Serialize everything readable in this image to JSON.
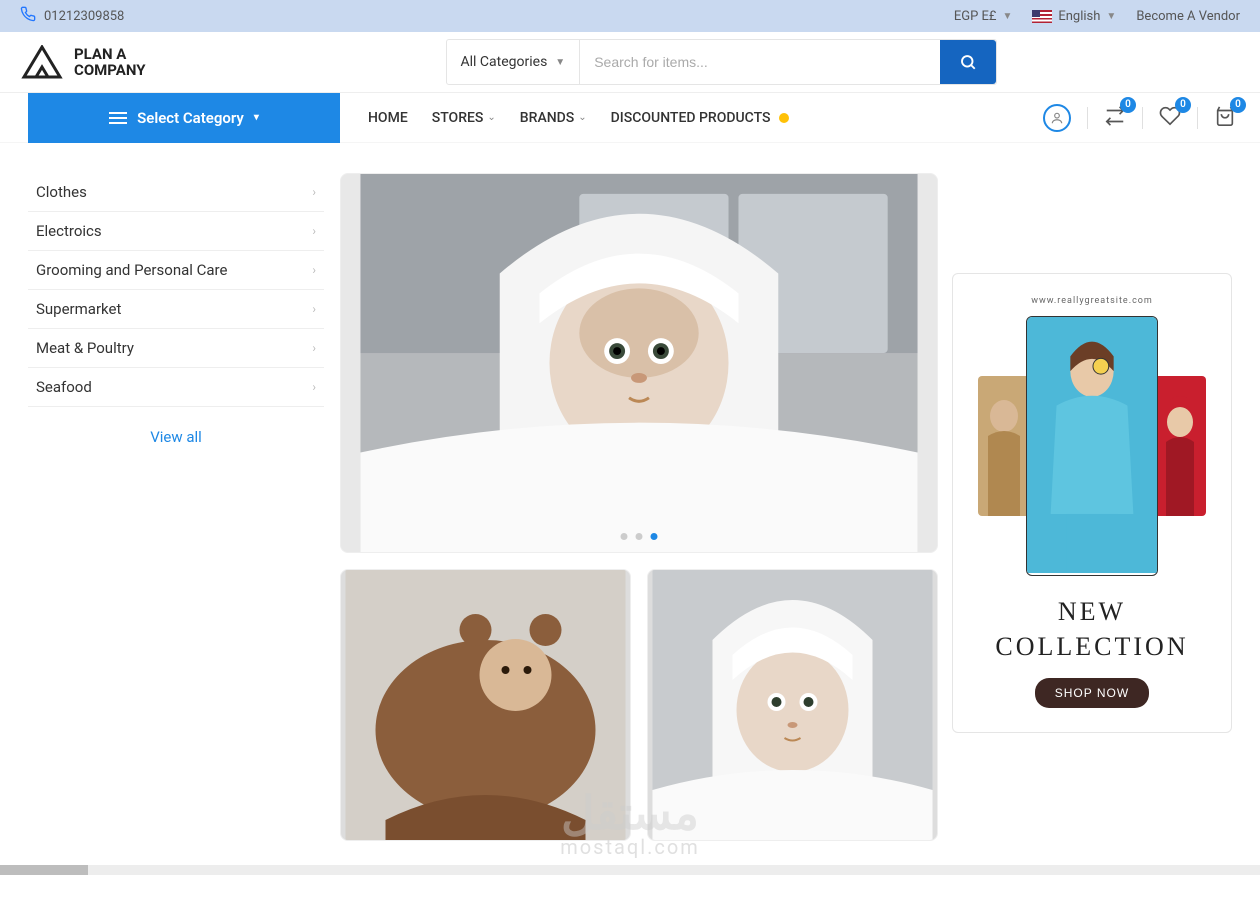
{
  "topbar": {
    "phone": "01212309858",
    "currency": "EGP E£",
    "language": "English",
    "vendor_link": "Become A Vendor"
  },
  "header": {
    "logo_line1": "PLAN A",
    "logo_line2": "COMPANY",
    "category_label": "All Categories",
    "search_placeholder": "Search for items..."
  },
  "nav": {
    "select_category": "Select Category",
    "links": [
      "HOME",
      "STORES",
      "BRANDS",
      "DISCOUNTED PRODUCTS"
    ],
    "badges": {
      "compare": "0",
      "wishlist": "0",
      "cart": "0"
    }
  },
  "sidebar": {
    "items": [
      {
        "label": "Clothes"
      },
      {
        "label": "Electroics"
      },
      {
        "label": "Grooming and Personal Care"
      },
      {
        "label": "Supermarket"
      },
      {
        "label": "Meat & Poultry"
      },
      {
        "label": "Seafood"
      }
    ],
    "view_all": "View all"
  },
  "banner": {
    "site": "www.reallygreatsite.com",
    "title_line1": "NEW",
    "title_line2": "COLLECTION",
    "shop_now": "SHOP NOW"
  },
  "watermark": {
    "main": "مستقل",
    "sub": "mostaql.com"
  }
}
